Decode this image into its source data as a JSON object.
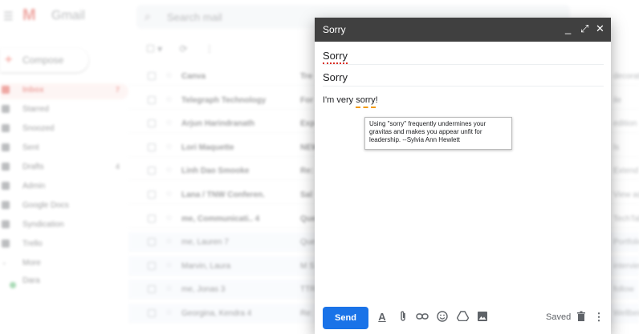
{
  "app": {
    "name": "Gmail"
  },
  "search": {
    "placeholder": "Search mail"
  },
  "sidebar": {
    "compose_label": "Compose",
    "items": [
      {
        "label": "Inbox",
        "count": "7",
        "active": true
      },
      {
        "label": "Starred",
        "count": ""
      },
      {
        "label": "Snoozed",
        "count": ""
      },
      {
        "label": "Sent",
        "count": ""
      },
      {
        "label": "Drafts",
        "count": "4"
      },
      {
        "label": "Admin",
        "count": ""
      },
      {
        "label": "Google Docs",
        "count": ""
      },
      {
        "label": "Syndication",
        "count": ""
      },
      {
        "label": "Trello",
        "count": ""
      },
      {
        "label": "More",
        "count": ""
      }
    ],
    "account": "Dara"
  },
  "mail_list": [
    {
      "sender": "Canva",
      "subject": "Tre",
      "snippet": "decorating",
      "read": false
    },
    {
      "sender": "Telegraph Technology",
      "subject": "For",
      "snippet": "ile",
      "read": false
    },
    {
      "sender": "Arjun Harindranath",
      "subject": "Exp",
      "snippet": "edition",
      "read": false
    },
    {
      "sender": "Lori Maquette",
      "subject": "NEW",
      "snippet": "ls",
      "read": false
    },
    {
      "sender": "Linh Dao Smooke",
      "subject": "Re:",
      "snippet": "Extend",
      "read": false
    },
    {
      "sender": "Lana / TNW Conferen.",
      "subject": "Sal",
      "snippet": "View ad",
      "read": false
    },
    {
      "sender": "me, Communicati.. 4",
      "subject": "Que",
      "snippet": "TechTalk",
      "read": false
    },
    {
      "sender": "me, Lauren 7",
      "subject": "Que",
      "snippet": "Portfolio",
      "read": true
    },
    {
      "sender": "Marvin, Laura",
      "subject": "M S",
      "snippet": "interview",
      "read": true
    },
    {
      "sender": "me, Jonas 3",
      "subject": "TTR",
      "snippet": "follow",
      "read": true
    },
    {
      "sender": "Georgina, Kendra 4",
      "subject": "Re:",
      "snippet": "Wellbeing",
      "read": true
    }
  ],
  "compose": {
    "window_title": "Sorry",
    "to_value": "Sorry",
    "subject_value": "Sorry",
    "body_text": "I'm very sorry!",
    "tooltip_text": "Using \"sorry\" frequently undermines your gravitas and makes you appear unfit for leadership. --Sylvia Ann Hewlett",
    "send_label": "Send",
    "saved_label": "Saved",
    "controls": {
      "minimize": "_",
      "expand": "⤢",
      "close": "✕"
    },
    "toolbar_icons": [
      "format-text-icon",
      "attach-icon",
      "link-icon",
      "emoji-icon",
      "drive-icon",
      "photo-icon"
    ]
  },
  "colors": {
    "compose_header": "#404040",
    "send_button": "#1a73e8",
    "spell_underline": "#d93025",
    "suggestion_underline": "#f29900",
    "brand_red": "#d93025"
  }
}
